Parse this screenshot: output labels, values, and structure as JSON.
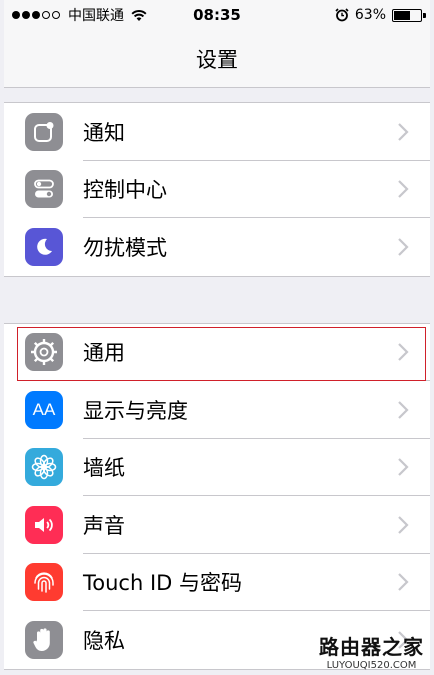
{
  "status_bar": {
    "carrier": "中国联通",
    "time": "08:35",
    "battery_percent": "63%",
    "battery_level": 0.63,
    "signal_bars_full": 3,
    "signal_bars_total": 5
  },
  "nav": {
    "title": "设置"
  },
  "groups": [
    {
      "items": [
        {
          "label": "通知",
          "icon": "notifications-icon",
          "color": "#8e8e93"
        },
        {
          "label": "控制中心",
          "icon": "control-center-icon",
          "color": "#8e8e93"
        },
        {
          "label": "勿扰模式",
          "icon": "moon-icon",
          "color": "#5856d6"
        }
      ]
    },
    {
      "items": [
        {
          "label": "通用",
          "icon": "gear-icon",
          "color": "#8e8e93"
        },
        {
          "label": "显示与亮度",
          "icon": "display-brightness-icon",
          "color": "#007aff",
          "icon_text": "AA"
        },
        {
          "label": "墙纸",
          "icon": "wallpaper-flower-icon",
          "color": "#34aadc"
        },
        {
          "label": "声音",
          "icon": "speaker-icon",
          "color": "#ff2d55"
        },
        {
          "label": "Touch ID 与密码",
          "icon": "fingerprint-icon",
          "color": "#ff3b30"
        },
        {
          "label": "隐私",
          "icon": "hand-icon",
          "color": "#8e8e93"
        }
      ]
    }
  ],
  "watermark": {
    "title": "路由器之家",
    "url": "LUYOUQI520.COM"
  },
  "highlight_color": "#d0202a"
}
